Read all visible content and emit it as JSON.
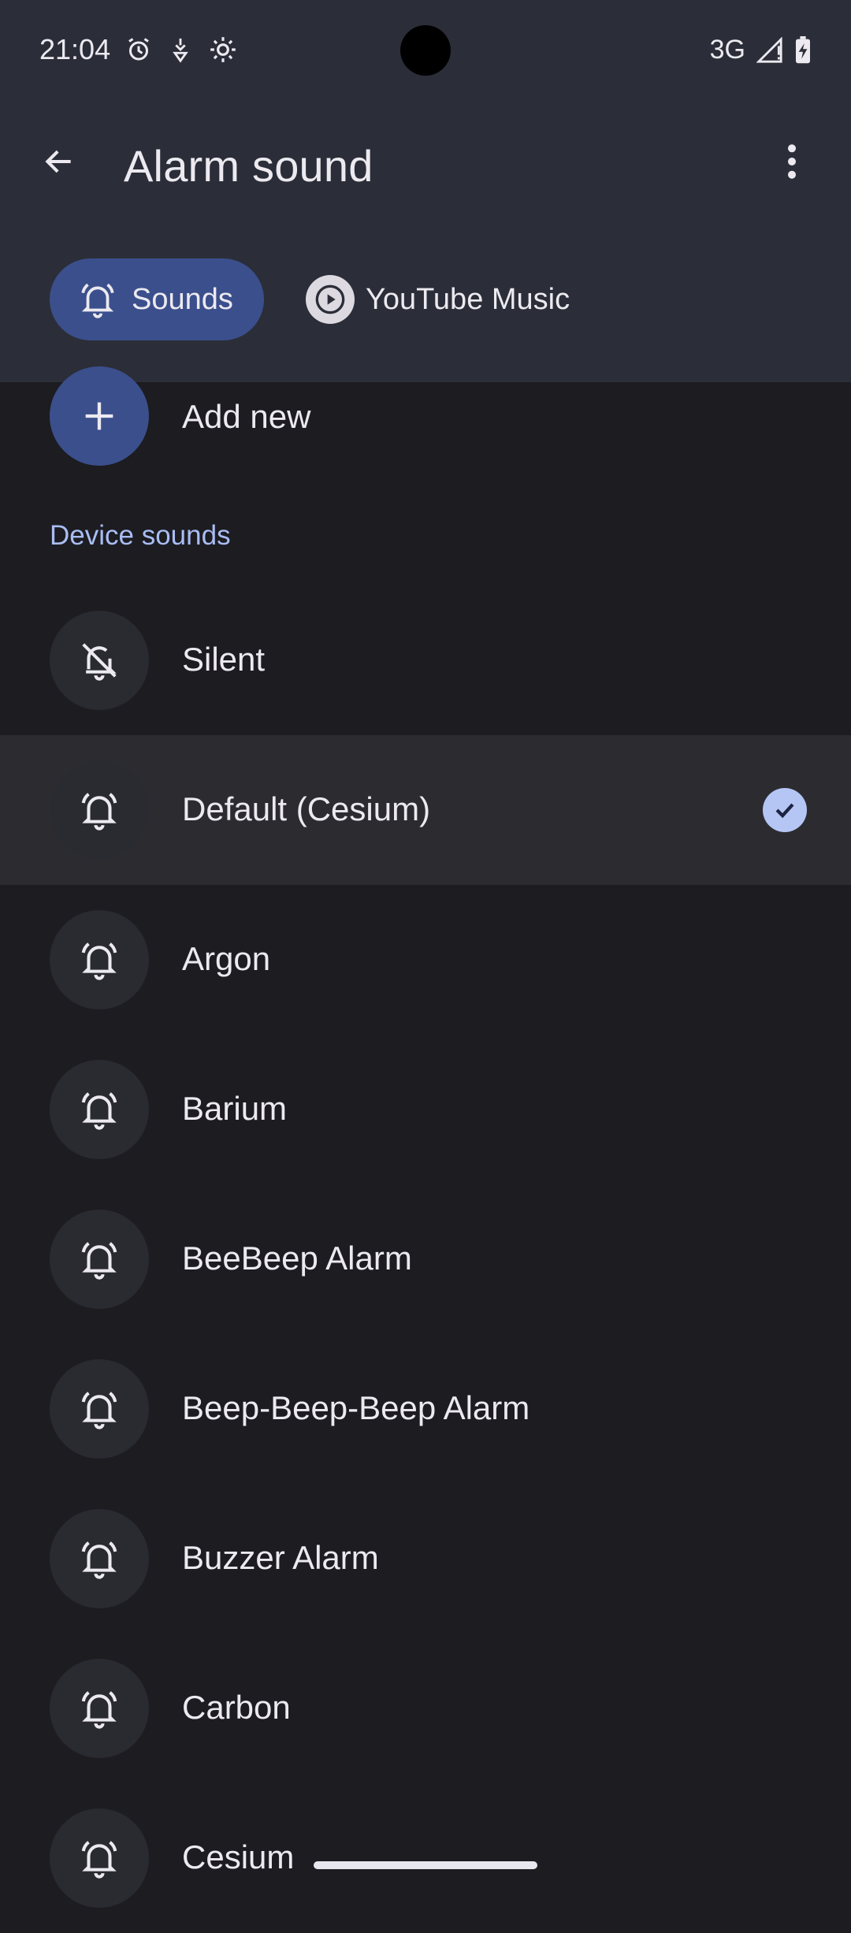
{
  "status_bar": {
    "time": "21:04",
    "network": "3G",
    "icons_left": [
      "alarm-icon",
      "location-icon",
      "settings-gear-icon"
    ],
    "icons_right": [
      "signal-icon",
      "battery-charging-icon"
    ]
  },
  "app_bar": {
    "title": "Alarm sound",
    "back_icon": "arrow-back-icon",
    "more_icon": "more-vert-icon"
  },
  "tabs": [
    {
      "label": "Sounds",
      "icon": "alarm-bell-icon",
      "selected": true
    },
    {
      "label": "YouTube Music",
      "icon": "play-circle-icon",
      "selected": false
    }
  ],
  "add_new": {
    "label": "Add new",
    "icon": "plus-icon"
  },
  "section": {
    "label": "Device sounds"
  },
  "sounds": [
    {
      "label": "Silent",
      "icon": "bell-off-icon",
      "selected": false
    },
    {
      "label": "Default (Cesium)",
      "icon": "alarm-bell-icon",
      "selected": true
    },
    {
      "label": "Argon",
      "icon": "alarm-bell-icon",
      "selected": false
    },
    {
      "label": "Barium",
      "icon": "alarm-bell-icon",
      "selected": false
    },
    {
      "label": "BeeBeep Alarm",
      "icon": "alarm-bell-icon",
      "selected": false
    },
    {
      "label": "Beep-Beep-Beep Alarm",
      "icon": "alarm-bell-icon",
      "selected": false
    },
    {
      "label": "Buzzer Alarm",
      "icon": "alarm-bell-icon",
      "selected": false
    },
    {
      "label": "Carbon",
      "icon": "alarm-bell-icon",
      "selected": false
    },
    {
      "label": "Cesium",
      "icon": "alarm-bell-icon",
      "selected": false
    }
  ],
  "colors": {
    "background": "#1c1c21",
    "header": "#2b2e38",
    "accent": "#3b4f8c",
    "section_text": "#a9bdf3",
    "check": "#b5c6f5"
  }
}
